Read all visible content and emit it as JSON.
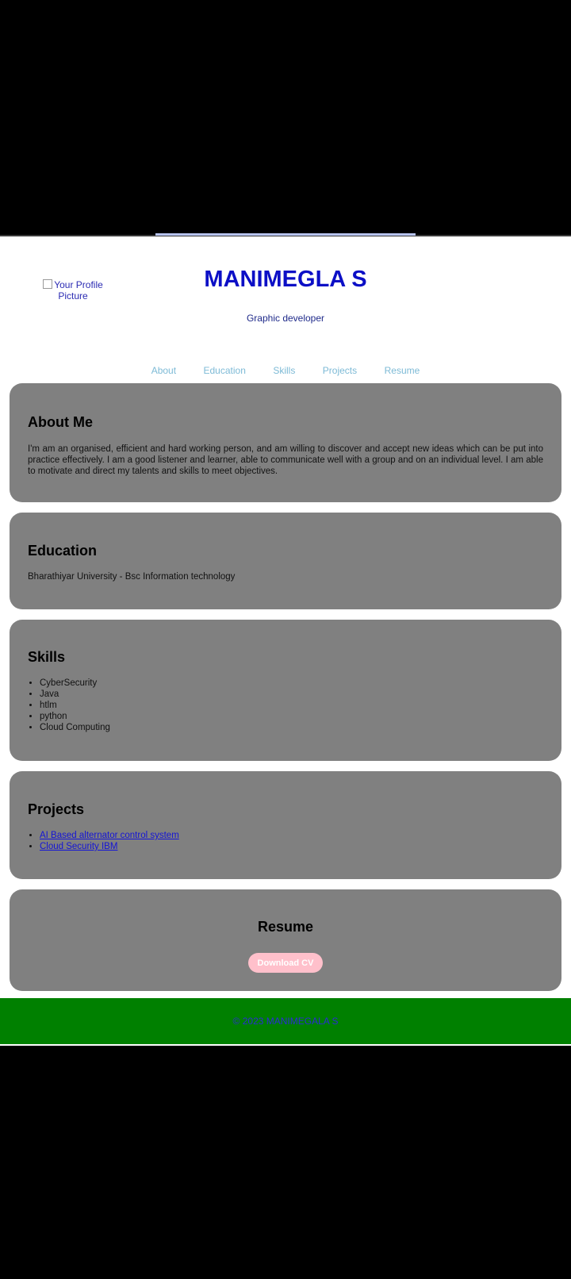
{
  "profile": {
    "image_alt": "Your Profile Picture",
    "name": "MANIMEGLA S",
    "tagline": "Graphic developer"
  },
  "nav": [
    "About",
    "Education",
    "Skills",
    "Projects",
    "Resume"
  ],
  "about": {
    "title": "About Me",
    "text": "I'm am an organised, efficient and hard working person, and am willing to discover and accept new ideas which can be put into practice effectively. I am a good listener and learner, able to communicate well with a group and on an individual level. I am able to motivate and direct my talents and skills to meet objectives."
  },
  "education": {
    "title": "Education",
    "text": "Bharathiyar University - Bsc Information technology"
  },
  "skills": {
    "title": "Skills",
    "items": [
      "CyberSecurity",
      "Java",
      "htlm",
      "python",
      "Cloud Computing"
    ]
  },
  "projects": {
    "title": "Projects",
    "items": [
      "AI Based alternator control system",
      "Cloud Security IBM"
    ]
  },
  "resume": {
    "title": "Resume",
    "button_label": "Download CV"
  },
  "footer": {
    "text": "© 2023 MANIMEGALA S"
  },
  "colors": {
    "name": "#0c0fc6",
    "nav": "#7dbad6",
    "section_bg": "#808080",
    "button_bg": "#ffc0cb",
    "footer_bg": "#008000",
    "footer_text": "#2b2bd6"
  }
}
